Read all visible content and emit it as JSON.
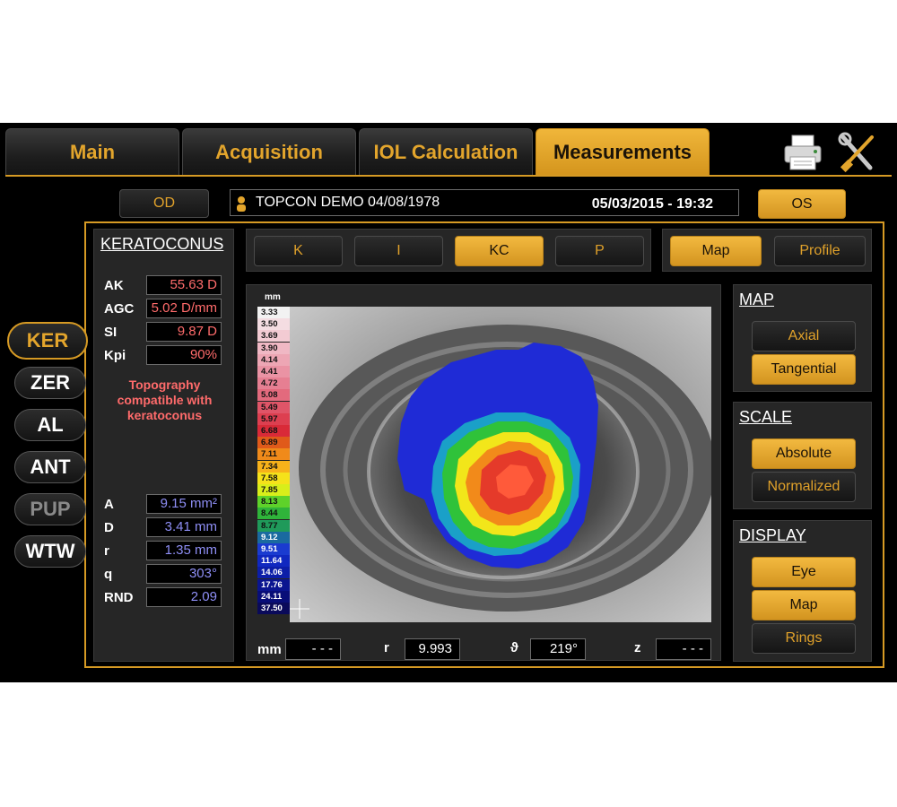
{
  "tabs": [
    {
      "label": "Main",
      "active": false
    },
    {
      "label": "Acquisition",
      "active": false
    },
    {
      "label": "IOL Calculation",
      "active": false
    },
    {
      "label": "Measurements",
      "active": true
    }
  ],
  "icons": {
    "print": "printer-icon",
    "settings": "tools-icon"
  },
  "patient_bar": {
    "od_label": "OD",
    "os_label": "OS",
    "patient": "TOPCON DEMO 04/08/1978",
    "datetime": "05/03/2015 - 19:32"
  },
  "side_nav": [
    "KER",
    "ZER",
    "AL",
    "ANT",
    "PUP",
    "WTW"
  ],
  "keratoconus": {
    "title": "KERATOCONUS",
    "rows": [
      {
        "label": "AK",
        "value": "55.63 D"
      },
      {
        "label": "AGC",
        "value": "5.02 D/mm"
      },
      {
        "label": "SI",
        "value": "9.87 D"
      },
      {
        "label": "Kpi",
        "value": "90%"
      }
    ],
    "message": "Topography compatible with keratoconus",
    "pupil_rows": [
      {
        "label": "A",
        "value": "9.15 mm²"
      },
      {
        "label": "D",
        "value": "3.41 mm"
      },
      {
        "label": "r",
        "value": "1.35 mm"
      },
      {
        "label": "q",
        "value": "303°"
      },
      {
        "label": "RND",
        "value": "2.09"
      }
    ]
  },
  "map_types": [
    "K",
    "I",
    "KC",
    "P"
  ],
  "map_types_active": "KC",
  "view_modes": [
    "Map",
    "Profile"
  ],
  "view_active": "Map",
  "color_scale": {
    "unit": "mm",
    "values": [
      "3.33",
      "3.50",
      "3.69",
      "3.90",
      "4.14",
      "4.41",
      "4.72",
      "5.08",
      "5.49",
      "5.97",
      "6.68",
      "6.89",
      "7.11",
      "7.34",
      "7.58",
      "7.85",
      "8.13",
      "8.44",
      "8.77",
      "9.12",
      "9.51",
      "11.64",
      "14.06",
      "17.76",
      "24.11",
      "37.50"
    ],
    "colors": [
      "#f2f2f2",
      "#f4dde2",
      "#f3cbd3",
      "#f0b8c4",
      "#eda6b4",
      "#ea93a4",
      "#e67f92",
      "#e36a7d",
      "#e05568",
      "#dd3f50",
      "#d92a38",
      "#e05a1a",
      "#f08a1a",
      "#f7b21a",
      "#f5e21a",
      "#d8ee1a",
      "#5ed22a",
      "#2fb43a",
      "#1f9a5a",
      "#1a6aa0",
      "#1a3bd0",
      "#1028c0",
      "#0c1ea8",
      "#0a1590",
      "#080e78",
      "#0a0a5a"
    ]
  },
  "readout": {
    "mm_label": "mm",
    "mm_value": "- - -",
    "r_label": "r",
    "r_value": "9.993",
    "theta_label": "ϑ",
    "theta_value": "219°",
    "z_label": "z",
    "z_value": "- - -"
  },
  "map_panel": {
    "title": "MAP",
    "options": [
      "Axial",
      "Tangential"
    ],
    "active": "Tangential"
  },
  "scale_panel": {
    "title": "SCALE",
    "options": [
      "Absolute",
      "Normalized"
    ],
    "active": "Absolute"
  },
  "display_panel": {
    "title": "DISPLAY",
    "options": [
      "Eye",
      "Map",
      "Rings"
    ],
    "active": [
      "Eye",
      "Map"
    ]
  },
  "colors": {
    "accent": "#d69a24",
    "warning_text": "#ff6b6b",
    "pupil_text": "#8e8ef5"
  }
}
